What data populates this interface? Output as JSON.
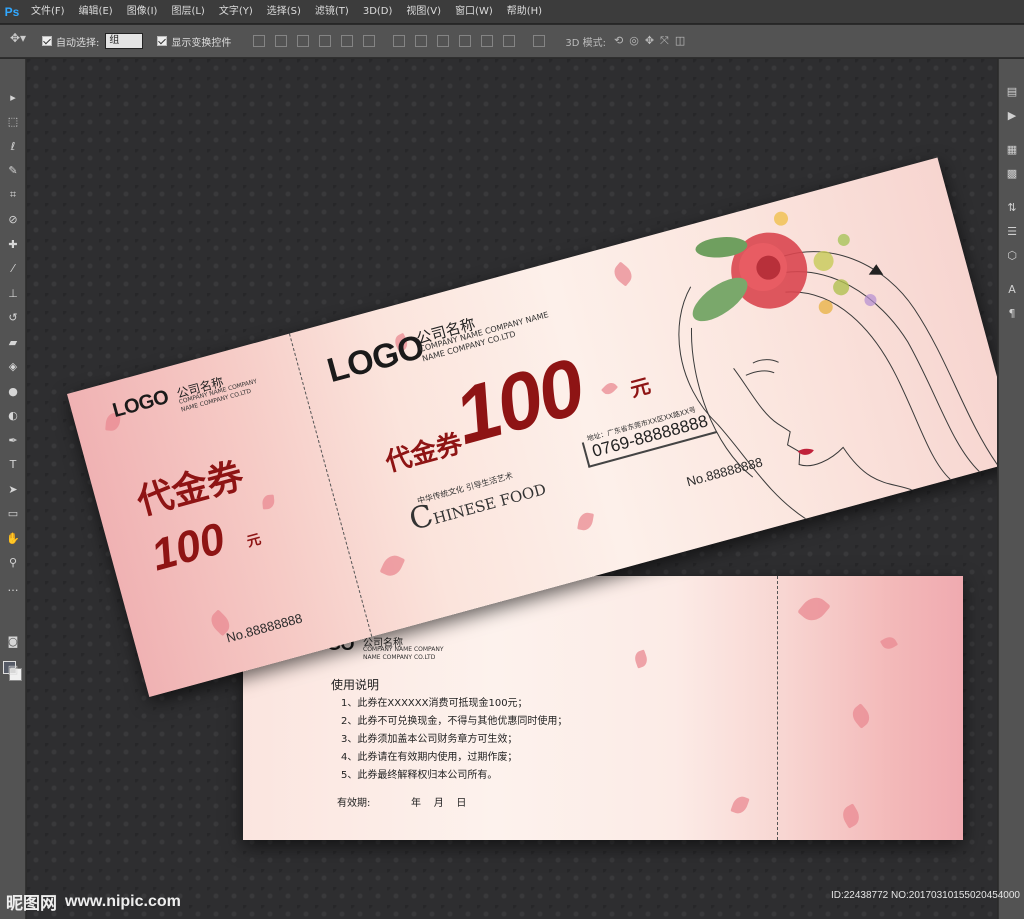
{
  "app": {
    "logo": "Ps",
    "menu": [
      "文件(F)",
      "编辑(E)",
      "图像(I)",
      "图层(L)",
      "文字(Y)",
      "选择(S)",
      "滤镜(T)",
      "3D(D)",
      "视图(V)",
      "窗口(W)",
      "帮助(H)"
    ]
  },
  "options": {
    "auto_select_label": "自动选择:",
    "auto_select_value": "组",
    "show_transform_label": "显示变换控件",
    "mode_3d_label": "3D 模式:"
  },
  "ticket": {
    "stub_logo": "LOGO",
    "stub_company": "公司名称",
    "stub_company_en": "COMPANY NAME COMPANY",
    "stub_company_en2": "NAME COMPANY CO.LTD",
    "stub_title": "代金券",
    "stub_amount": "100",
    "stub_unit": "元",
    "stub_no": "No.88888888",
    "main_logo": "LOGO",
    "main_company": "公司名称",
    "main_company_en": "COMPANY NAME COMPANY NAME",
    "main_company_en2": "NAME COMPANY CO.LTD",
    "main_title": "代金券",
    "main_amount": "100",
    "main_unit": "元",
    "slogan": "中华传统文化 引导生活艺术",
    "brand_letter": "C",
    "brand_rest": "HINESE FOOD",
    "address_label": "地址：广东省东莞市XX区XX路XX号",
    "phone": "0769-88888888",
    "main_no": "No.88888888"
  },
  "card": {
    "logo": "LOGO",
    "company": "公司名称",
    "company_en": "COMPANY NAME COMPANY",
    "company_en2": "NAME COMPANY CO.LTD",
    "rules_title": "使用说明",
    "rules": [
      "1、此券在XXXXXX消费可抵现金100元；",
      "2、此券不可兑换现金，不得与其他优惠同时使用；",
      "3、此券须加盖本公司财务章方可生效；",
      "4、此券请在有效期内使用，过期作废；",
      "5、此券最终解释权归本公司所有。"
    ],
    "validity_label": "有效期:",
    "validity_date": "年    月    日"
  },
  "watermark": {
    "site_cn": "昵图网",
    "site_url": "www.nipic.com",
    "id_text": "ID:22438772 NO:20170310155020454000"
  },
  "colors": {
    "accent_red": "#8e1414",
    "ps_blue": "#31a8ff",
    "panel_gray": "#535353"
  }
}
